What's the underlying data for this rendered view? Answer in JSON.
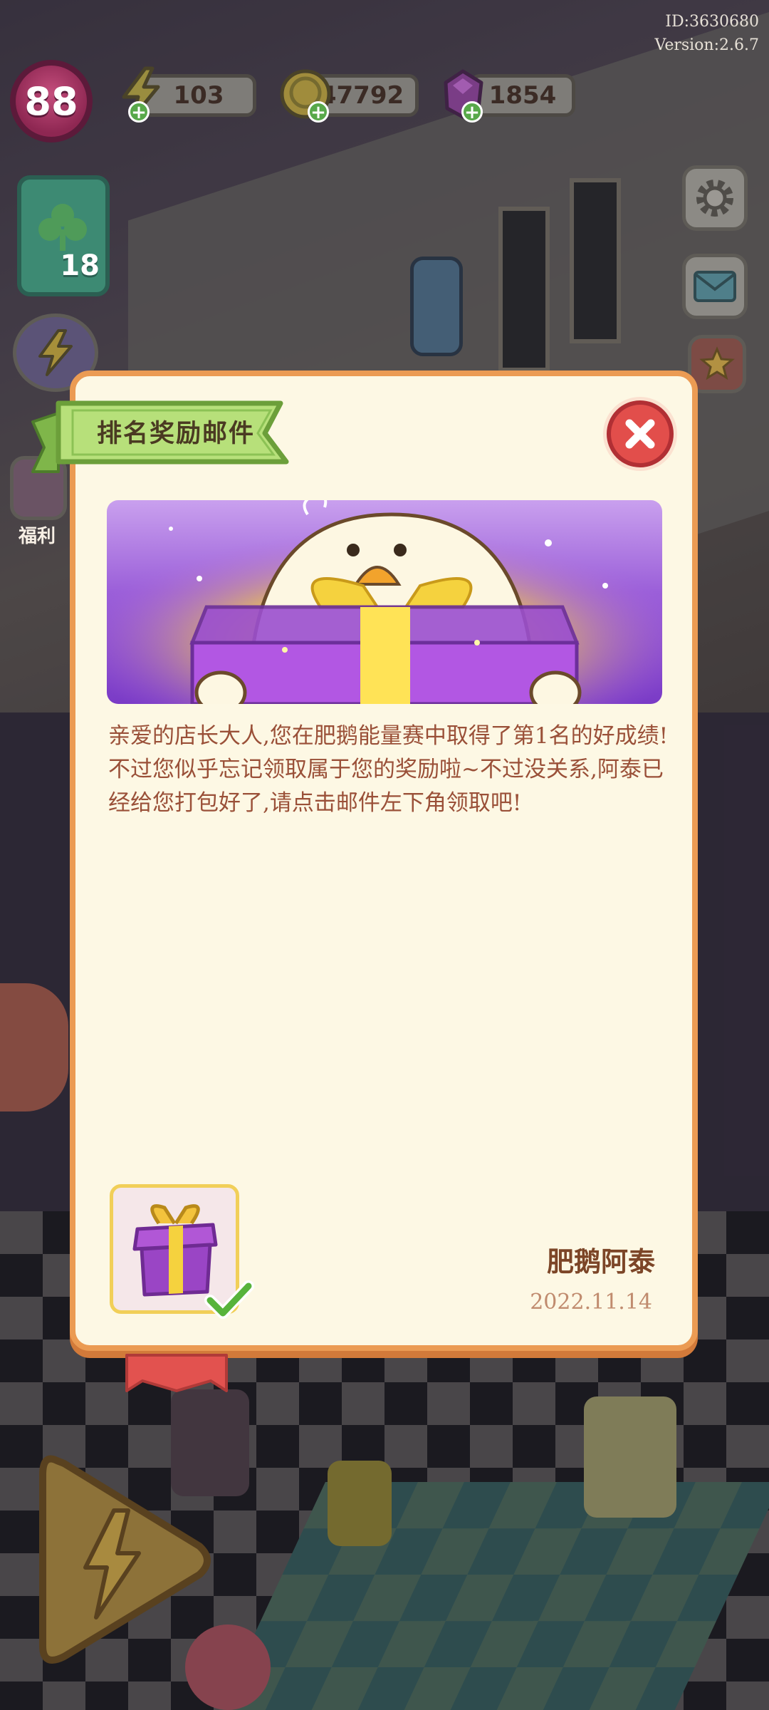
{
  "hud": {
    "level": "88",
    "energy": "103",
    "coins": "47792",
    "gems": "1854",
    "build_id": "ID:3630680",
    "version": "Version:2.6.7",
    "card_count": "18",
    "side_label": "福利"
  },
  "mail": {
    "title": "排名奖励邮件",
    "body": "亲爱的店长大人,您在肥鹅能量赛中取得了第1名的好成绩!不过您似乎忘记领取属于您的奖励啦~不过没关系,阿泰已经给您打包好了,请点击邮件左下角领取吧!",
    "sender": "肥鹅阿泰",
    "date": "2022.11.14",
    "attachment_icon": "gift-box-icon",
    "attachment_status": "claimed-check-icon"
  },
  "icons": {
    "energy": "lightning-icon",
    "coins": "coin-icon",
    "gems": "gem-icon",
    "settings": "gear-icon",
    "mail": "mail-icon",
    "close": "close-icon"
  },
  "colors": {
    "dialog_bg": "#fdf8e4",
    "dialog_border": "#eb9b53",
    "ribbon_green": "#a8d66a",
    "close_red": "#e24e4b",
    "body_text": "#9a5038",
    "banner_purple": "#9b5fd9"
  }
}
